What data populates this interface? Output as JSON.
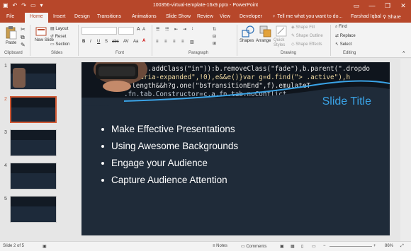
{
  "titlebar": {
    "title": "100356-virtual-template-16x9.pptx - PowerPoint",
    "controls": {
      "minimize": "—",
      "restore": "❐",
      "close": "✕"
    }
  },
  "tabs": {
    "file": "File",
    "home": "Home",
    "insert": "Insert",
    "design": "Design",
    "transitions": "Transitions",
    "animations": "Animations",
    "slideshow": "Slide Show",
    "review": "Review",
    "view": "View",
    "developer": "Developer",
    "tellme": "Tell me what you want to do...",
    "user": "Farshad Iqbal",
    "share": "Share"
  },
  "ribbon": {
    "clipboard": {
      "label": "Clipboard",
      "paste": "Paste"
    },
    "slides": {
      "label": "Slides",
      "new_slide": "New Slide",
      "layout": "Layout",
      "reset": "Reset",
      "section": "Section"
    },
    "font": {
      "label": "Font"
    },
    "paragraph": {
      "label": "Paragraph"
    },
    "drawing": {
      "label": "Drawing",
      "shapes": "Shapes",
      "arrange": "Arrange",
      "quick_styles": "Quick Styles",
      "shape_fill": "Shape Fill",
      "shape_outline": "Shape Outline",
      "shape_effects": "Shape Effects"
    },
    "editing": {
      "label": "Editing",
      "find": "Find",
      "replace": "Replace",
      "select": "Select"
    }
  },
  "thumbnails": [
    {
      "num": "1",
      "selected": false
    },
    {
      "num": "2",
      "selected": true
    },
    {
      "num": "3",
      "selected": false
    },
    {
      "num": "4",
      "selected": false
    },
    {
      "num": "5",
      "selected": false
    }
  ],
  "slide": {
    "title": "Slide Title",
    "bullets": [
      "Make Effective Presentations",
      "Using Awesome Backgrounds",
      "Engage your Audience",
      "Capture Audience Attention"
    ],
    "code_lines": [
      {
        "a": "idth,b.addClass(\"in\")):b.removeClass(\"fade\"),b.parent(\".dropdo",
        "c": ""
      },
      {
        "a": "tr(\"aria-expanded\",!0),e&&e()}var g=d.find(\"> .active\"),h",
        "c": ""
      },
      {
        "a": "g.length&&h?g.one(\"bsTransitionEnd\",f).emulateT",
        "c": ""
      },
      {
        "a": ".fn.tab.Constructor=c,a.fn.tab.noConflict",
        "c": ""
      }
    ]
  },
  "statusbar": {
    "slide_count": "Slide 2 of 5",
    "notes": "Notes",
    "comments": "Comments",
    "zoom": "86%"
  },
  "colors": {
    "accent": "#b7472a",
    "slide_title": "#3aa3e6",
    "slide_bg": "#1f2b39"
  }
}
